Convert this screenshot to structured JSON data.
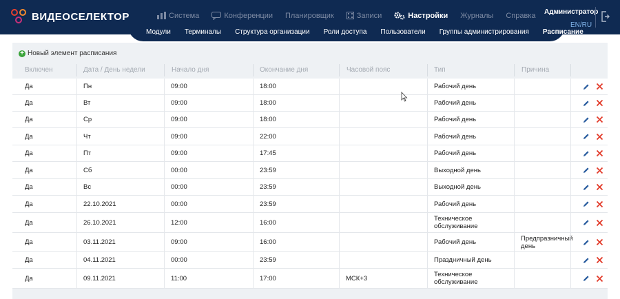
{
  "brand": {
    "name": "ВИДЕОСЕЛЕКТОР",
    "accent": "#e8402f",
    "header_bg": "#0f2a52"
  },
  "top_nav": [
    {
      "label": "Система",
      "icon": "bar-chart-icon",
      "active": false
    },
    {
      "label": "Конференции",
      "icon": "chat-bubble-icon",
      "active": false
    },
    {
      "label": "Планировщик",
      "icon": "",
      "active": false
    },
    {
      "label": "Записи",
      "icon": "film-icon",
      "active": false
    },
    {
      "label": "Настройки",
      "icon": "gears-icon",
      "active": true
    },
    {
      "label": "Журналы",
      "icon": "",
      "active": false
    },
    {
      "label": "Справка",
      "icon": "",
      "active": false
    }
  ],
  "user": {
    "name": "Администратор",
    "lang": "EN/RU"
  },
  "sub_nav": [
    {
      "label": "Модули",
      "active": false
    },
    {
      "label": "Терминалы",
      "active": false
    },
    {
      "label": "Структура организации",
      "active": false
    },
    {
      "label": "Роли доступа",
      "active": false
    },
    {
      "label": "Пользователи",
      "active": false
    },
    {
      "label": "Группы администрирования",
      "active": false
    },
    {
      "label": "Расписание",
      "active": true
    }
  ],
  "add_label": "Новый элемент расписания",
  "columns": [
    "Включен",
    "Дата / День недели",
    "Начало дня",
    "Окончание дня",
    "Часовой пояс",
    "Тип",
    "Причина"
  ],
  "rows": [
    {
      "enabled": "Да",
      "date": "Пн",
      "start": "09:00",
      "end": "18:00",
      "tz": "",
      "type": "Рабочий день",
      "reason": ""
    },
    {
      "enabled": "Да",
      "date": "Вт",
      "start": "09:00",
      "end": "18:00",
      "tz": "",
      "type": "Рабочий день",
      "reason": ""
    },
    {
      "enabled": "Да",
      "date": "Ср",
      "start": "09:00",
      "end": "18:00",
      "tz": "",
      "type": "Рабочий день",
      "reason": ""
    },
    {
      "enabled": "Да",
      "date": "Чт",
      "start": "09:00",
      "end": "22:00",
      "tz": "",
      "type": "Рабочий день",
      "reason": ""
    },
    {
      "enabled": "Да",
      "date": "Пт",
      "start": "09:00",
      "end": "17:45",
      "tz": "",
      "type": "Рабочий день",
      "reason": ""
    },
    {
      "enabled": "Да",
      "date": "Сб",
      "start": "00:00",
      "end": "23:59",
      "tz": "",
      "type": "Выходной день",
      "reason": ""
    },
    {
      "enabled": "Да",
      "date": "Вс",
      "start": "00:00",
      "end": "23:59",
      "tz": "",
      "type": "Выходной день",
      "reason": ""
    },
    {
      "enabled": "Да",
      "date": "22.10.2021",
      "start": "00:00",
      "end": "23:59",
      "tz": "",
      "type": "Рабочий день",
      "reason": ""
    },
    {
      "enabled": "Да",
      "date": "26.10.2021",
      "start": "12:00",
      "end": "16:00",
      "tz": "",
      "type": "Техническое обслуживание",
      "reason": ""
    },
    {
      "enabled": "Да",
      "date": "03.11.2021",
      "start": "09:00",
      "end": "16:00",
      "tz": "",
      "type": "Рабочий день",
      "reason": "Предпразничный день"
    },
    {
      "enabled": "Да",
      "date": "04.11.2021",
      "start": "00:00",
      "end": "23:59",
      "tz": "",
      "type": "Праздничный день",
      "reason": ""
    },
    {
      "enabled": "Да",
      "date": "09.11.2021",
      "start": "11:00",
      "end": "17:00",
      "tz": "МСК+3",
      "type": "Техническое обслуживание",
      "reason": ""
    }
  ]
}
